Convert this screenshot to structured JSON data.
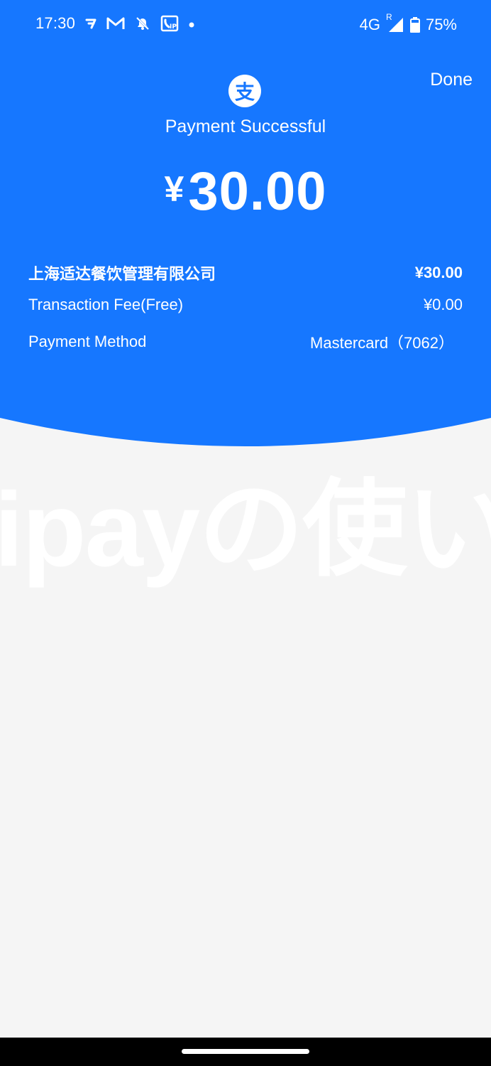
{
  "colors": {
    "brand": "#1677ff",
    "page_background": "#f5f5f5",
    "text_on_brand": "#ffffff"
  },
  "status_bar": {
    "time": "17:30",
    "left_icons": [
      "carrier-t-icon",
      "gmail-icon",
      "mute-icon",
      "caller-ip-icon",
      "dot-icon"
    ],
    "network": "4G",
    "roaming": "R",
    "battery": "75%",
    "battery_level": 0.75
  },
  "header": {
    "done_label": "Done",
    "logo_glyph": "支",
    "logo_icon": "alipay-logo-icon",
    "title": "Payment Successful"
  },
  "amount": {
    "currency": "¥",
    "value": "30.00"
  },
  "details": {
    "merchant": {
      "label": "上海适达餐饮管理有限公司",
      "value": "¥30.00"
    },
    "fee": {
      "label": "Transaction Fee(Free)",
      "value": "¥0.00"
    },
    "method": {
      "label": "Payment Method",
      "value": "Mastercard（7062）"
    }
  },
  "watermark": {
    "text": "ipayの使い"
  }
}
